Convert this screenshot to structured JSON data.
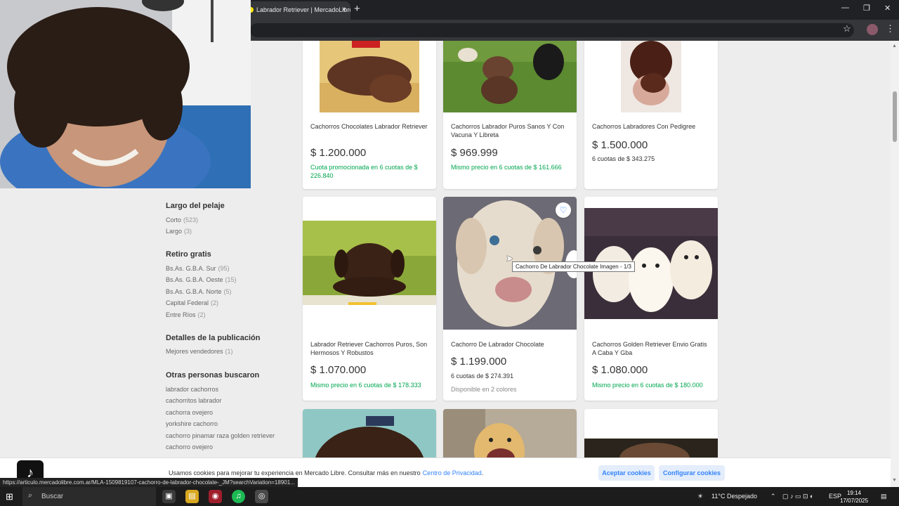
{
  "browser": {
    "tab_title": "Labrador Retriever | MercadoLibre",
    "new_tab": "+",
    "close_tab": "×",
    "star": "☆",
    "menu": "⋮",
    "minimize": "—",
    "restore": "❐",
    "close_window": "✕"
  },
  "sidebar": {
    "fur_length": {
      "title": "Largo del pelaje",
      "items": [
        {
          "label": "Corto",
          "count": "(523)"
        },
        {
          "label": "Largo",
          "count": "(3)"
        }
      ]
    },
    "pickup": {
      "title": "Retiro gratis",
      "items": [
        {
          "label": "Bs.As. G.B.A. Sur",
          "count": "(95)"
        },
        {
          "label": "Bs.As. G.B.A. Oeste",
          "count": "(15)"
        },
        {
          "label": "Bs.As. G.B.A. Norte",
          "count": "(5)"
        },
        {
          "label": "Capital Federal",
          "count": "(2)"
        },
        {
          "label": "Entre Ríos",
          "count": "(2)"
        }
      ]
    },
    "details": {
      "title": "Detalles de la publicación",
      "items": [
        {
          "label": "Mejores vendedores",
          "count": "(1)"
        }
      ]
    },
    "related": {
      "title": "Otras personas buscaron",
      "items": [
        "labrador cachorros",
        "cachorritos labrador",
        "cachorra ovejero",
        "yorkshire cachorro",
        "cachorro pinamar raza golden retriever",
        "cachorro ovejero"
      ]
    }
  },
  "products": [
    {
      "title": "Cachorros Chocolates Labrador Retriever",
      "price": "$ 1.200.000",
      "installments": "Cuota promocionada en 6 cuotas de $ 226.840"
    },
    {
      "title": "Cachorros Labrador Puros Sanos Y Con Vacuna Y Libreta",
      "price": "$ 969.999",
      "installments": "Mismo precio en 6 cuotas de $ 161.666"
    },
    {
      "title": "Cachorros Labradores Con Pedigree",
      "price": "$ 1.500.000",
      "installments": "6 cuotas de $ 343.275"
    },
    {
      "title": "Labrador Retriever Cachorros Puros, Son Hermosos Y Robustos",
      "price": "$ 1.070.000",
      "installments": "Mismo precio en 6 cuotas de $ 178.333"
    },
    {
      "title": "Cachorro De Labrador Chocolate",
      "price": "$ 1.199.000",
      "installments": "6 cuotas de $ 274.391",
      "variants": "Disponible en 2 colores"
    },
    {
      "title": "Cachorros Golden Retriever Envio Gratis A Caba Y Gba",
      "price": "$ 1.080.000",
      "installments": "Mismo precio en 6 cuotas de $ 180.000"
    }
  ],
  "tooltip": "Cachorro De Labrador  Chocolate Imagen - 1/3",
  "cookie": {
    "text": "Usamos cookies para mejorar tu experiencia en Mercado Libre. Consultar más en nuestro",
    "link": "Centro de Privacidad",
    "accept": "Aceptar cookies",
    "configure": "Configurar cookies"
  },
  "status_url": "https://articulo.mercadolibre.com.ar/MLA-1509819107-cachorro-de-labrador-chocolate-_JM?searchVariation=18901...",
  "taskbar": {
    "search": "Buscar",
    "weather": "11°C  Despejado",
    "lang": "ESP",
    "time": "19:14",
    "date": "17/07/2025"
  },
  "colors": {
    "accent": "#3483fa",
    "green": "#00a650",
    "page_bg": "#ededed"
  }
}
